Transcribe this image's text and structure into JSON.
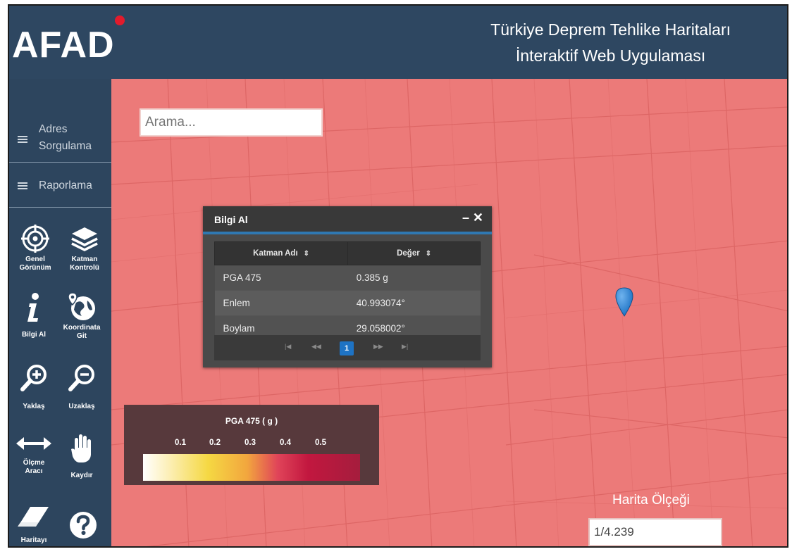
{
  "header": {
    "logo": "AFAD",
    "title_line1": "Türkiye Deprem Tehlike Haritaları",
    "title_line2": "İnteraktif Web Uygulaması"
  },
  "sidebar": {
    "links": [
      {
        "label_line1": "Adres",
        "label_line2": "Sorgulama",
        "icon": "list-icon"
      },
      {
        "label": "Raporlama",
        "icon": "list-icon"
      }
    ],
    "tools": [
      {
        "label_line1": "Genel",
        "label_line2": "Görünüm",
        "icon": "target-icon"
      },
      {
        "label_line1": "Katman",
        "label_line2": "Kontrolü",
        "icon": "layers-icon"
      },
      {
        "label": "Bilgi Al",
        "icon": "info-icon"
      },
      {
        "label_line1": "Koordinata",
        "label_line2": "Git",
        "icon": "globe-pin-icon"
      },
      {
        "label": "Yaklaş",
        "icon": "zoom-in-icon"
      },
      {
        "label": "Uzaklaş",
        "icon": "zoom-out-icon"
      },
      {
        "label_line1": "Ölçme",
        "label_line2": "Aracı",
        "icon": "measure-arrow-icon"
      },
      {
        "label": "Kaydır",
        "icon": "hand-icon"
      },
      {
        "label": "Haritayı",
        "icon": "eraser-icon"
      },
      {
        "label": "",
        "icon": "help-icon"
      }
    ]
  },
  "map": {
    "search_placeholder": "Arama...",
    "scale_label": "Harita Ölçeği",
    "scale_value": "1/4.239",
    "background_color": "#ec7a79",
    "marker_color": "#1e73c4"
  },
  "popup": {
    "title": "Bilgi Al",
    "minimize": "–",
    "close": "✕",
    "columns": [
      "Katman Adı",
      "Değer"
    ],
    "sort_icon": "⇕",
    "rows": [
      {
        "name": "PGA 475",
        "value": "0.385 g"
      },
      {
        "name": "Enlem",
        "value": "40.993074°"
      },
      {
        "name": "Boylam",
        "value": "29.058002°"
      }
    ],
    "pager": {
      "first": "|◀",
      "prev": "◀◀",
      "current": "1",
      "next": "▶▶",
      "last": "▶|"
    }
  },
  "legend": {
    "title": "PGA 475 ( g )",
    "ticks": [
      "0.1",
      "0.2",
      "0.3",
      "0.4",
      "0.5"
    ]
  }
}
